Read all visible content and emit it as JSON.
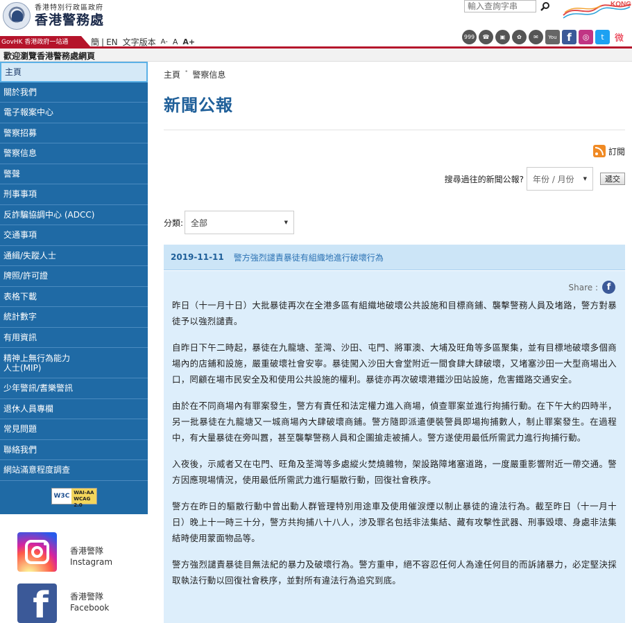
{
  "header": {
    "gov_name": "香港特別行政區政府",
    "dept_name": "香港警務處",
    "search_placeholder": "輸入查詢字串",
    "brand_logo_text": "KONG",
    "govhk_label": "GovHK 香港政府一站通",
    "lang": {
      "simplified": "簡",
      "english": "EN",
      "text_version": "文字版本",
      "font_small": "A-",
      "font_medium": "A",
      "font_large": "A+"
    },
    "social": [
      {
        "name": "999-icon",
        "label": "999"
      },
      {
        "name": "phone-icon",
        "label": "☎"
      },
      {
        "name": "app-icon",
        "label": "▣"
      },
      {
        "name": "share-icon",
        "label": "✿"
      },
      {
        "name": "mail-icon",
        "label": "✉"
      },
      {
        "name": "youtube-icon",
        "label": "You"
      },
      {
        "name": "facebook-icon",
        "label": "f"
      },
      {
        "name": "instagram-icon",
        "label": "◎"
      },
      {
        "name": "twitter-icon",
        "label": "t"
      },
      {
        "name": "weibo-icon",
        "label": "微"
      }
    ]
  },
  "welcome": "歡迎瀏覽香港警務處網頁",
  "sidebar": {
    "items": [
      {
        "label": "主頁",
        "active": true
      },
      {
        "label": "關於我們"
      },
      {
        "label": "電子報案中心"
      },
      {
        "label": "警察招募"
      },
      {
        "label": "警察信息"
      },
      {
        "label": "警聲"
      },
      {
        "label": "刑事事項"
      },
      {
        "label": "反詐騙協調中心 (ADCC)"
      },
      {
        "label": "交通事項"
      },
      {
        "label": "通緝/失蹤人士"
      },
      {
        "label": "牌照/許可證"
      },
      {
        "label": "表格下載"
      },
      {
        "label": "統計數字"
      },
      {
        "label": "有用資訊"
      },
      {
        "label": "精神上無行為能力\n人士(MIP)",
        "tall": true
      },
      {
        "label": "少年警訊/耆樂警訊"
      },
      {
        "label": "退休人員專欄"
      },
      {
        "label": "常見問題"
      },
      {
        "label": "聯絡我們"
      },
      {
        "label": "網站滿意程度調查"
      }
    ],
    "wcag": {
      "w3c": "W3C",
      "level": "WAI-AA",
      "version": "WCAG 2.0"
    },
    "instagram": {
      "line1": "香港警隊",
      "line2": "Instagram"
    },
    "facebook": {
      "line1": "香港警隊",
      "line2": "Facebook"
    }
  },
  "main": {
    "breadcrumb": {
      "home": "主頁",
      "current": "警察信息"
    },
    "title": "新聞公報",
    "subscribe": "訂閱",
    "archive_label": "搜尋過往的新聞公報?",
    "month_select": "年份 / 月份",
    "submit": "遞交",
    "category_label": "分類:",
    "category_value": "全部",
    "article": {
      "date": "2019-11-11",
      "title": "警方強烈譴責暴徒有組織地進行破壞行為",
      "share": "Share :",
      "paragraphs": [
        "昨日（十一月十日）大批暴徒再次在全港多區有組織地破壞公共設施和目標商鋪、襲擊警務人員及堵路，警方對暴徒予以強烈譴責。",
        "自昨日下午二時起，暴徒在九龍塘、荃灣、沙田、屯門、將軍澳、大埔及旺角等多區聚集，並有目標地破壞多個商場內的店鋪和設施，嚴重破壞社會安寧。暴徒闖入沙田大會堂附近一間食肆大肆破壞，又堵塞沙田一大型商場出入口，罔顧在場市民安全及和使用公共設施的權利。暴徒亦再次破壞港鐵沙田站設施，危害鐵路交通安全。",
        "由於在不同商場內有罪案發生，警方有責任和法定權力進入商場，偵查罪案並進行拘捕行動。在下午大約四時半，另一批暴徒在九龍塘又一城商場內大肆破壞商鋪。警方隨即派遣便裝警員即場拘捕數人，制止罪案發生。在過程中，有大量暴徒在旁叫囂，甚至襲擊警務人員和企圖搶走被捕人。警方遂使用最低所需武力進行拘捕行動。",
        "入夜後，示威者又在屯門、旺角及荃灣等多處縱火焚燒雜物，架設路障堵塞道路，一度嚴重影響附近一帶交通。警方因應現場情況，使用最低所需武力進行驅散行動，回復社會秩序。",
        "警方在昨日的驅散行動中曾出動人群管理特別用途車及使用催淚煙以制止暴徒的違法行為。截至昨日（十一月十日）晚上十一時三十分，警方共拘捕八十八人，涉及罪名包括非法集結、藏有攻擊性武器、刑事毀壞、身處非法集結時使用蒙面物品等。",
        "警方強烈譴責暴徒目無法紀的暴力及破壞行為。警方重申，絕不容忍任何人為達任何目的而訴諸暴力，必定堅決採取執法行動以回復社會秩序，並對所有違法行為追究到底。"
      ]
    }
  }
}
